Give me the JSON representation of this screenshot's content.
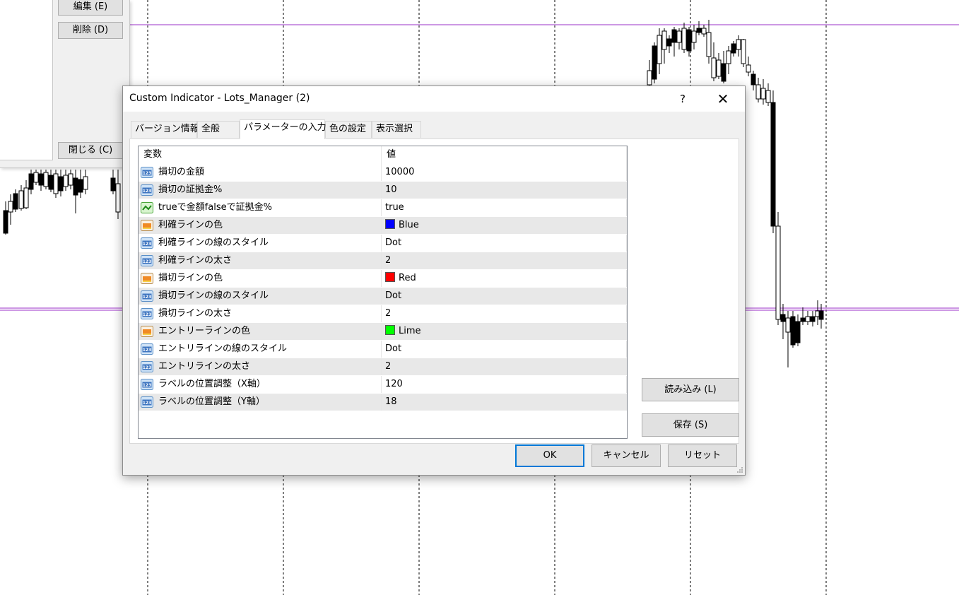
{
  "chart_colors": {
    "hline": "#9b30c8",
    "grid": "#000000",
    "candle_up": "#ffffff",
    "candle_down": "#000000"
  },
  "background_panel": {
    "buttons": [
      "編集 (E)",
      "削除 (D)",
      "閉じる (C)"
    ]
  },
  "dialog": {
    "title": "Custom Indicator - Lots_Manager (2)",
    "help_label": "?",
    "close_label": "✕",
    "tabs": [
      {
        "label": "バージョン情報",
        "active": false
      },
      {
        "label": "全般",
        "active": false
      },
      {
        "label": "パラメーターの入力",
        "active": true
      },
      {
        "label": "色の設定",
        "active": false
      },
      {
        "label": "表示選択",
        "active": false
      }
    ],
    "table": {
      "headers": [
        "変数",
        "値"
      ],
      "rows": [
        {
          "icon": "number-icon",
          "name": "損切の金額",
          "value": "10000"
        },
        {
          "icon": "number-icon",
          "name": "損切の証拠金%",
          "value": "10"
        },
        {
          "icon": "boolean-icon",
          "name": "trueで金額falseで証拠金%",
          "value": "true"
        },
        {
          "icon": "color-icon",
          "name": "利確ラインの色",
          "value": "Blue",
          "swatch": "#0000ff"
        },
        {
          "icon": "number-icon",
          "name": "利確ラインの線のスタイル",
          "value": "Dot"
        },
        {
          "icon": "number-icon",
          "name": "利確ラインの太さ",
          "value": "2"
        },
        {
          "icon": "color-icon",
          "name": "損切ラインの色",
          "value": "Red",
          "swatch": "#ff0000"
        },
        {
          "icon": "number-icon",
          "name": "損切ラインの線のスタイル",
          "value": "Dot"
        },
        {
          "icon": "number-icon",
          "name": "損切ラインの太さ",
          "value": "2"
        },
        {
          "icon": "color-icon",
          "name": "エントリーラインの色",
          "value": "Lime",
          "swatch": "#00ff00"
        },
        {
          "icon": "number-icon",
          "name": "エントリラインの線のスタイル",
          "value": "Dot"
        },
        {
          "icon": "number-icon",
          "name": "エントリラインの太さ",
          "value": "2"
        },
        {
          "icon": "number-icon",
          "name": "ラベルの位置調整（X軸）",
          "value": "120"
        },
        {
          "icon": "number-icon",
          "name": "ラベルの位置調整（Y軸）",
          "value": "18"
        }
      ]
    },
    "load_button": "読み込み (L)",
    "save_button": "保存 (S)",
    "ok_button": "OK",
    "cancel_button": "キャンセル",
    "reset_button": "リセット"
  }
}
